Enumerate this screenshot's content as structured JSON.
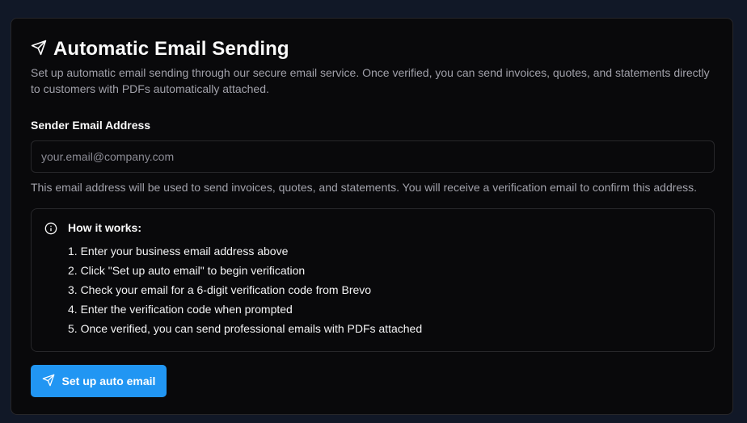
{
  "card": {
    "title": "Automatic Email Sending",
    "title_icon": "send-icon",
    "description": "Set up automatic email sending through our secure email service. Once verified, you can send invoices, quotes, and statements directly to customers with PDFs automatically attached."
  },
  "form": {
    "sender_label": "Sender Email Address",
    "email_value": "",
    "email_placeholder": "your.email@company.com",
    "hint": "This email address will be used to send invoices, quotes, and statements. You will receive a verification email to confirm this address."
  },
  "how_it_works": {
    "icon": "info-icon",
    "title": "How it works:",
    "steps": [
      "1. Enter your business email address above",
      "2. Click \"Set up auto email\" to begin verification",
      "3. Check your email for a 6-digit verification code from Brevo",
      "4. Enter the verification code when prompted",
      "5. Once verified, you can send professional emails with PDFs attached"
    ]
  },
  "action": {
    "button_label": "Set up auto email",
    "button_icon": "send-icon",
    "button_color": "#2196f3"
  }
}
